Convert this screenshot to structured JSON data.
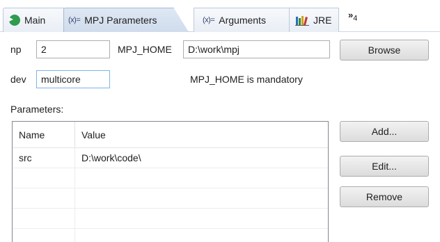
{
  "tabs": {
    "main": {
      "label": "Main",
      "icon": "main-tab-icon"
    },
    "mpj_parameters": {
      "label": "MPJ Parameters",
      "icon_text": "(x)="
    },
    "arguments": {
      "label": "Arguments",
      "icon_text": "(x)="
    },
    "jre": {
      "label": "JRE",
      "icon": "jre-library-icon"
    },
    "overflow": {
      "symbol": "»",
      "count": "4"
    }
  },
  "form": {
    "np": {
      "label": "np",
      "value": "2"
    },
    "mpj_home": {
      "label": "MPJ_HOME",
      "value": "D:\\work\\mpj"
    },
    "browse_label": "Browse",
    "dev": {
      "label": "dev",
      "value": "multicore"
    },
    "message": "MPJ_HOME is mandatory"
  },
  "parameters": {
    "label": "Parameters:",
    "columns": [
      "Name",
      "Value"
    ],
    "rows": [
      [
        "src",
        "D:\\work\\code\\"
      ],
      [
        "",
        ""
      ],
      [
        "",
        ""
      ],
      [
        "",
        ""
      ],
      [
        "",
        ""
      ]
    ],
    "buttons": {
      "add": "Add...",
      "edit": "Edit...",
      "remove": "Remove"
    }
  },
  "colors": {
    "active_tab": "#cfdcec",
    "main_icon": "#2e9b4f",
    "focus_border": "#7eb4ea"
  }
}
